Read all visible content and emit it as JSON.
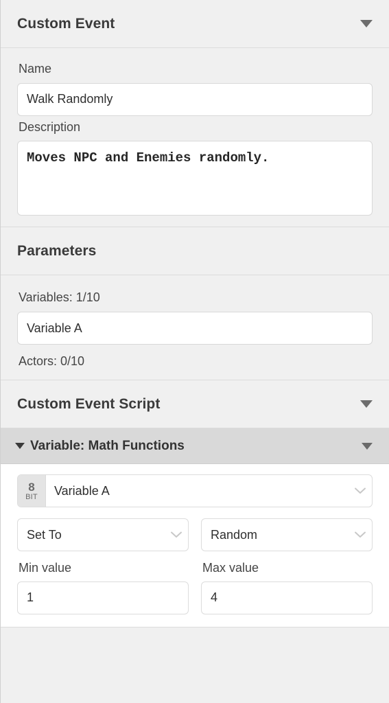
{
  "sections": {
    "custom_event": {
      "title": "Custom Event",
      "collapse_icon": "triangle-down-icon",
      "name_label": "Name",
      "name_value": "Walk Randomly",
      "description_label": "Description",
      "description_value": "Moves NPC and Enemies randomly."
    },
    "parameters": {
      "title": "Parameters",
      "variables_count": "Variables: 1/10",
      "variable_value": "Variable A",
      "actors_count": "Actors: 0/10"
    },
    "custom_event_script": {
      "title": "Custom Event Script",
      "collapse_icon": "triangle-down-icon",
      "block": {
        "title": "Variable: Math Functions",
        "expand_icon": "triangle-down-icon",
        "collapse_icon": "triangle-down-icon",
        "variable": {
          "badge_num": "8",
          "badge_unit": "BIT",
          "value": "Variable A"
        },
        "operation": "Set To",
        "function": "Random",
        "min_label": "Min value",
        "min_value": "1",
        "max_label": "Max value",
        "max_value": "4"
      }
    }
  },
  "colors": {
    "panel_bg": "#f0f0f0",
    "band_bg": "#d9d9d9",
    "script_bg": "#ffffff",
    "border": "#dcdcdc",
    "text": "#3a3a3a"
  }
}
